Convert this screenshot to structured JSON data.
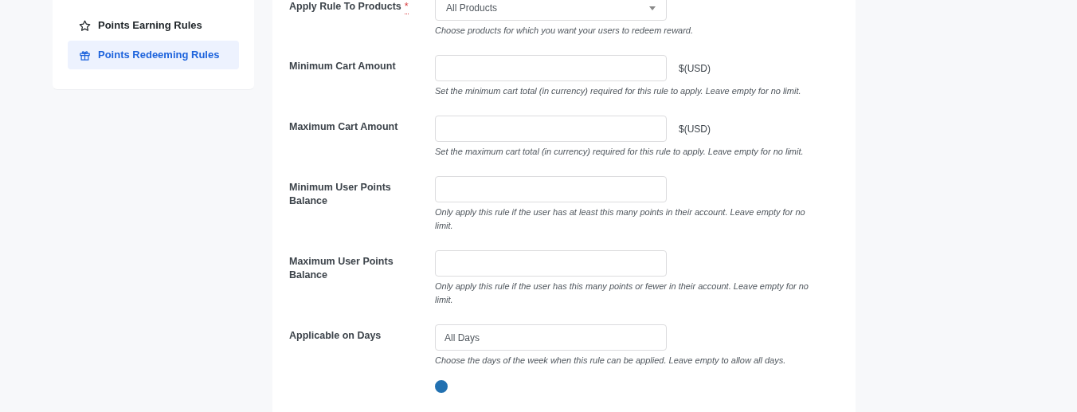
{
  "sidebar": {
    "items": [
      {
        "label": "Points Earning Rules",
        "selected": false
      },
      {
        "label": "Points Redeeming Rules",
        "selected": true
      }
    ]
  },
  "fields": [
    {
      "kind": "select",
      "label": "Apply Rule To Products",
      "required_mark": "*",
      "value": "All Products",
      "help": "Choose products for which you want your users to redeem reward."
    },
    {
      "kind": "input",
      "label": "Minimum Cart Amount",
      "suffix": "$(USD)",
      "help": "Set the minimum cart total (in currency) required for this rule to apply. Leave empty for no limit."
    },
    {
      "kind": "input",
      "label": "Maximum Cart Amount",
      "suffix": "$(USD)",
      "help": "Set the maximum cart total (in currency) required for this rule to apply. Leave empty for no limit."
    },
    {
      "kind": "input",
      "label": "Minimum User Points Balance",
      "help": "Only apply this rule if the user has at least this many points in their account. Leave empty for no limit."
    },
    {
      "kind": "input",
      "label": "Maximum User Points Balance",
      "help": "Only apply this rule if the user has this many points or fewer in their account. Leave empty for no limit."
    },
    {
      "kind": "input",
      "label": "Applicable on Days",
      "value": "All Days",
      "help": "Choose the days of the week when this rule can be applied. Leave empty to allow all days."
    },
    {
      "kind": "radio",
      "options": [
        {
          "selected": true
        }
      ]
    }
  ]
}
